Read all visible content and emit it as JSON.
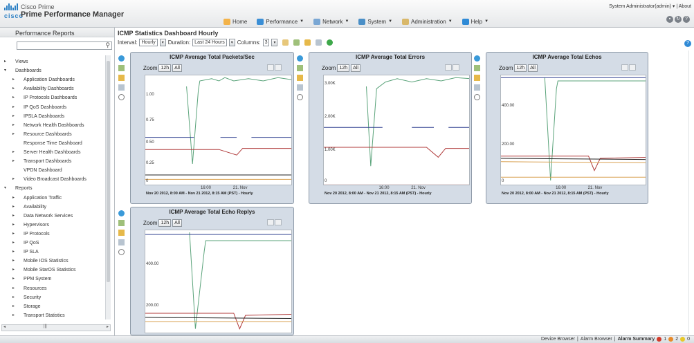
{
  "header": {
    "brand_line1": "Cisco Prime",
    "brand_line2": "Prime Performance Manager",
    "logo_text": "cisco",
    "user_line": "System Administrator(admin) ▾  |  About",
    "nav": [
      {
        "label": "Home",
        "icon": "home-icon",
        "color": "#f3b34a"
      },
      {
        "label": "Performance",
        "icon": "performance-icon",
        "color": "#3b8fd6"
      },
      {
        "label": "Network",
        "icon": "network-icon",
        "color": "#7aa7d4"
      },
      {
        "label": "System",
        "icon": "system-icon",
        "color": "#4a8fc7"
      },
      {
        "label": "Administration",
        "icon": "administration-icon",
        "color": "#d9b86a"
      },
      {
        "label": "Help",
        "icon": "help-icon",
        "color": "#2f8ad6"
      }
    ]
  },
  "sidebar": {
    "title": "Performance Reports",
    "search_placeholder": "",
    "items": [
      {
        "label": "Views",
        "level": 1,
        "toggle": "▸"
      },
      {
        "label": "Dashboards",
        "level": 1,
        "toggle": "▾"
      },
      {
        "label": "Application Dashboards",
        "level": 2,
        "toggle": "▸"
      },
      {
        "label": "Availability Dashboards",
        "level": 2,
        "toggle": "▸"
      },
      {
        "label": "IP Protocols Dashboards",
        "level": 2,
        "toggle": "▸"
      },
      {
        "label": "IP QoS Dashboards",
        "level": 2,
        "toggle": "▸"
      },
      {
        "label": "IPSLA Dashboards",
        "level": 2,
        "toggle": "▸"
      },
      {
        "label": "Network Health Dashboards",
        "level": 2,
        "toggle": "▸"
      },
      {
        "label": "Resource Dashboards",
        "level": 2,
        "toggle": "▸"
      },
      {
        "label": "Response Time Dashboard",
        "level": 2,
        "toggle": ""
      },
      {
        "label": "Server Health Dashboards",
        "level": 2,
        "toggle": "▸"
      },
      {
        "label": "Transport Dashboards",
        "level": 2,
        "toggle": "▸"
      },
      {
        "label": "VPDN Dashboard",
        "level": 2,
        "toggle": ""
      },
      {
        "label": "Video Broadcast Dashboards",
        "level": 2,
        "toggle": "▸"
      },
      {
        "label": "Reports",
        "level": 1,
        "toggle": "▾"
      },
      {
        "label": "Application Traffic",
        "level": 2,
        "toggle": "▸"
      },
      {
        "label": "Availability",
        "level": 2,
        "toggle": "▸"
      },
      {
        "label": "Data Network Services",
        "level": 2,
        "toggle": "▸"
      },
      {
        "label": "Hypervisors",
        "level": 2,
        "toggle": "▸"
      },
      {
        "label": "IP Protocols",
        "level": 2,
        "toggle": "▸"
      },
      {
        "label": "IP QoS",
        "level": 2,
        "toggle": "▸"
      },
      {
        "label": "IP SLA",
        "level": 2,
        "toggle": "▸"
      },
      {
        "label": "Mobile IOS Statistics",
        "level": 2,
        "toggle": "▸"
      },
      {
        "label": "Mobile StarOS Statistics",
        "level": 2,
        "toggle": "▸"
      },
      {
        "label": "PPM System",
        "level": 2,
        "toggle": "▸"
      },
      {
        "label": "Resources",
        "level": 2,
        "toggle": "▸"
      },
      {
        "label": "Security",
        "level": 2,
        "toggle": "▸"
      },
      {
        "label": "Storage",
        "level": 2,
        "toggle": "▸"
      },
      {
        "label": "Transport Statistics",
        "level": 2,
        "toggle": "▸"
      }
    ]
  },
  "main": {
    "title": "ICMP Statistics Dashboard Hourly",
    "interval_label": "Interval:",
    "interval_value": "Hourly",
    "duration_label": "Duration:",
    "duration_value": "Last 24 Hours",
    "columns_label": "Columns:",
    "columns_value": "3"
  },
  "dashlets": [
    {
      "title": "ICMP Average Total Packets/Sec",
      "zoom_label": "Zoom",
      "zoom_12h": "12h",
      "zoom_all": "All",
      "yticks": [
        "1.00",
        "0.75",
        "0.50",
        "0.25",
        "0"
      ],
      "xticks": [
        "16:00",
        "21. Nov"
      ],
      "subtitle": "Nov 20 2012, 8:00 AM - Nov 21 2012, 8:15 AM (PST) - Hourly"
    },
    {
      "title": "ICMP Average Total Errors",
      "zoom_label": "Zoom",
      "zoom_12h": "12h",
      "zoom_all": "All",
      "yticks": [
        "3.00K",
        "2.00K",
        "1.00K",
        "0"
      ],
      "xticks": [
        "16:00",
        "21. Nov"
      ],
      "subtitle": "Nov 20 2012, 8:00 AM - Nov 21 2012, 8:15 AM (PST) - Hourly"
    },
    {
      "title": "ICMP Average Total Echos",
      "zoom_label": "Zoom",
      "zoom_12h": "12h",
      "zoom_all": "All",
      "yticks": [
        "400.00",
        "200.00",
        "0"
      ],
      "xticks": [
        "16:00",
        "21. Nov"
      ],
      "subtitle": "Nov 20 2012, 8:00 AM - Nov 21 2012, 8:15 AM (PST) - Hourly"
    },
    {
      "title": "ICMP Average Total Echo Replys",
      "zoom_label": "Zoom",
      "zoom_12h": "12h",
      "zoom_all": "All",
      "yticks": [
        "400.00",
        "200.00"
      ],
      "xticks": [],
      "subtitle": ""
    }
  ],
  "status": {
    "device_browser": "Device Browser",
    "alarm_browser": "Alarm Browser",
    "alarm_summary": "Alarm Summary",
    "critical_count": "1",
    "major_count": "2",
    "minor_count": "0"
  },
  "colors": {
    "green": "#5aa37a",
    "blue": "#2e3f8f",
    "red": "#b03a3a",
    "orange": "#d9a050",
    "black": "#222222"
  }
}
